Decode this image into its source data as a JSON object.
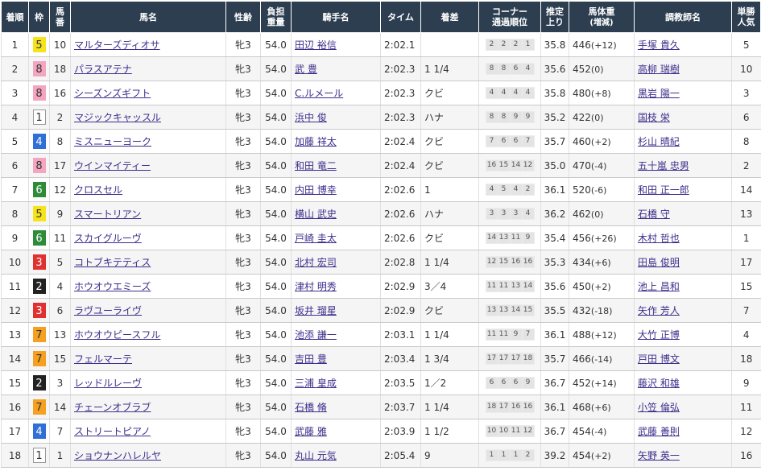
{
  "headers": {
    "rank": "着順",
    "waku": "枠",
    "umaban_1": "馬",
    "umaban_2": "番",
    "horse": "馬名",
    "sexage": "性齢",
    "weight_1": "負担",
    "weight_2": "重量",
    "jockey": "騎手名",
    "time": "タイム",
    "margin": "着差",
    "corner_1": "コーナー",
    "corner_2": "通過順位",
    "last_1": "推定",
    "last_2": "上り",
    "bw_1": "馬体重",
    "bw_2": "(増減)",
    "trainer": "調教師名",
    "odds_1": "単勝",
    "odds_2": "人気"
  },
  "waku_colors": {
    "1": {
      "bg": "#ffffff",
      "fg": "#333333",
      "border": "#999999"
    },
    "2": {
      "bg": "#222222",
      "fg": "#ffffff",
      "border": "#222222"
    },
    "3": {
      "bg": "#e03030",
      "fg": "#ffffff",
      "border": "#e03030"
    },
    "4": {
      "bg": "#2f6fd6",
      "fg": "#ffffff",
      "border": "#2f6fd6"
    },
    "5": {
      "bg": "#f5e31c",
      "fg": "#333333",
      "border": "#f5e31c"
    },
    "6": {
      "bg": "#2e8b3a",
      "fg": "#ffffff",
      "border": "#2e8b3a"
    },
    "7": {
      "bg": "#f5a020",
      "fg": "#333333",
      "border": "#f5a020"
    },
    "8": {
      "bg": "#f4a6c0",
      "fg": "#333333",
      "border": "#f4a6c0"
    }
  },
  "rows": [
    {
      "rank": "1",
      "waku": "5",
      "umaban": "10",
      "horse": "マルターズディオサ",
      "sexage": "牝3",
      "weight": "54.0",
      "jockey": "田辺 裕信",
      "time": "2:02.1",
      "margin": "",
      "corner": [
        "2",
        "2",
        "2",
        "1"
      ],
      "last": "35.8",
      "bw": "446",
      "bwdiff": "(+12)",
      "trainer": "手塚 貴久",
      "pop": "5"
    },
    {
      "rank": "2",
      "waku": "8",
      "umaban": "18",
      "horse": "パラスアテナ",
      "sexage": "牝3",
      "weight": "54.0",
      "jockey": "武 豊",
      "time": "2:02.3",
      "margin": "1 1/4",
      "corner": [
        "8",
        "8",
        "6",
        "4"
      ],
      "last": "35.6",
      "bw": "452",
      "bwdiff": "(0)",
      "trainer": "高柳 瑞樹",
      "pop": "10"
    },
    {
      "rank": "3",
      "waku": "8",
      "umaban": "16",
      "horse": "シーズンズギフト",
      "sexage": "牝3",
      "weight": "54.0",
      "jockey": "C.ルメール",
      "time": "2:02.3",
      "margin": "クビ",
      "corner": [
        "4",
        "4",
        "4",
        "4"
      ],
      "last": "35.8",
      "bw": "480",
      "bwdiff": "(+8)",
      "trainer": "黒岩 陽一",
      "pop": "3"
    },
    {
      "rank": "4",
      "waku": "1",
      "umaban": "2",
      "horse": "マジックキャッスル",
      "sexage": "牝3",
      "weight": "54.0",
      "jockey": "浜中 俊",
      "time": "2:02.3",
      "margin": "ハナ",
      "corner": [
        "8",
        "8",
        "9",
        "9"
      ],
      "last": "35.2",
      "bw": "422",
      "bwdiff": "(0)",
      "trainer": "国枝 栄",
      "pop": "6"
    },
    {
      "rank": "5",
      "waku": "4",
      "umaban": "8",
      "horse": "ミスニューヨーク",
      "sexage": "牝3",
      "weight": "54.0",
      "jockey": "加藤 祥太",
      "time": "2:02.4",
      "margin": "クビ",
      "corner": [
        "7",
        "6",
        "6",
        "7"
      ],
      "last": "35.7",
      "bw": "460",
      "bwdiff": "(+2)",
      "trainer": "杉山 晴紀",
      "pop": "8"
    },
    {
      "rank": "6",
      "waku": "8",
      "umaban": "17",
      "horse": "ウインマイティー",
      "sexage": "牝3",
      "weight": "54.0",
      "jockey": "和田 竜二",
      "time": "2:02.4",
      "margin": "クビ",
      "corner": [
        "16",
        "15",
        "14",
        "12"
      ],
      "last": "35.0",
      "bw": "470",
      "bwdiff": "(-4)",
      "trainer": "五十嵐 忠男",
      "pop": "2"
    },
    {
      "rank": "7",
      "waku": "6",
      "umaban": "12",
      "horse": "クロスセル",
      "sexage": "牝3",
      "weight": "54.0",
      "jockey": "内田 博幸",
      "time": "2:02.6",
      "margin": "1",
      "corner": [
        "4",
        "5",
        "4",
        "2"
      ],
      "last": "36.1",
      "bw": "520",
      "bwdiff": "(-6)",
      "trainer": "和田 正一郎",
      "pop": "14"
    },
    {
      "rank": "8",
      "waku": "5",
      "umaban": "9",
      "horse": "スマートリアン",
      "sexage": "牝3",
      "weight": "54.0",
      "jockey": "横山 武史",
      "time": "2:02.6",
      "margin": "ハナ",
      "corner": [
        "3",
        "3",
        "3",
        "4"
      ],
      "last": "36.2",
      "bw": "462",
      "bwdiff": "(0)",
      "trainer": "石橋 守",
      "pop": "13"
    },
    {
      "rank": "9",
      "waku": "6",
      "umaban": "11",
      "horse": "スカイグルーヴ",
      "sexage": "牝3",
      "weight": "54.0",
      "jockey": "戸崎 圭太",
      "time": "2:02.6",
      "margin": "クビ",
      "corner": [
        "14",
        "13",
        "11",
        "9"
      ],
      "last": "35.4",
      "bw": "456",
      "bwdiff": "(+26)",
      "trainer": "木村 哲也",
      "pop": "1"
    },
    {
      "rank": "10",
      "waku": "3",
      "umaban": "5",
      "horse": "コトブキテティス",
      "sexage": "牝3",
      "weight": "54.0",
      "jockey": "北村 宏司",
      "time": "2:02.8",
      "margin": "1 1/4",
      "corner": [
        "12",
        "15",
        "16",
        "16"
      ],
      "last": "35.3",
      "bw": "434",
      "bwdiff": "(+6)",
      "trainer": "田島 俊明",
      "pop": "17"
    },
    {
      "rank": "11",
      "waku": "2",
      "umaban": "4",
      "horse": "ホウオウエミーズ",
      "sexage": "牝3",
      "weight": "54.0",
      "jockey": "津村 明秀",
      "time": "2:02.9",
      "margin": "3／4",
      "corner": [
        "11",
        "11",
        "13",
        "14"
      ],
      "last": "35.6",
      "bw": "450",
      "bwdiff": "(+2)",
      "trainer": "池上 昌和",
      "pop": "15"
    },
    {
      "rank": "12",
      "waku": "3",
      "umaban": "6",
      "horse": "ラヴユーライヴ",
      "sexage": "牝3",
      "weight": "54.0",
      "jockey": "坂井 瑠星",
      "time": "2:02.9",
      "margin": "クビ",
      "corner": [
        "13",
        "13",
        "14",
        "15"
      ],
      "last": "35.5",
      "bw": "432",
      "bwdiff": "(-18)",
      "trainer": "矢作 芳人",
      "pop": "7"
    },
    {
      "rank": "13",
      "waku": "7",
      "umaban": "13",
      "horse": "ホウオウピースフル",
      "sexage": "牝3",
      "weight": "54.0",
      "jockey": "池添 謙一",
      "time": "2:03.1",
      "margin": "1 1/4",
      "corner": [
        "11",
        "11",
        "9",
        "7"
      ],
      "last": "36.1",
      "bw": "488",
      "bwdiff": "(+12)",
      "trainer": "大竹 正博",
      "pop": "4"
    },
    {
      "rank": "14",
      "waku": "7",
      "umaban": "15",
      "horse": "フェルマーテ",
      "sexage": "牝3",
      "weight": "54.0",
      "jockey": "吉田 豊",
      "time": "2:03.4",
      "margin": "1 3/4",
      "corner": [
        "17",
        "17",
        "17",
        "18"
      ],
      "last": "35.7",
      "bw": "466",
      "bwdiff": "(-14)",
      "trainer": "戸田 博文",
      "pop": "18"
    },
    {
      "rank": "15",
      "waku": "2",
      "umaban": "3",
      "horse": "レッドルレーヴ",
      "sexage": "牝3",
      "weight": "54.0",
      "jockey": "三浦 皇成",
      "time": "2:03.5",
      "margin": "1／2",
      "corner": [
        "6",
        "6",
        "6",
        "9"
      ],
      "last": "36.7",
      "bw": "452",
      "bwdiff": "(+14)",
      "trainer": "藤沢 和雄",
      "pop": "9"
    },
    {
      "rank": "16",
      "waku": "7",
      "umaban": "14",
      "horse": "チェーンオブラブ",
      "sexage": "牝3",
      "weight": "54.0",
      "jockey": "石橋 脩",
      "time": "2:03.7",
      "margin": "1 1/4",
      "corner": [
        "18",
        "17",
        "16",
        "16"
      ],
      "last": "36.1",
      "bw": "468",
      "bwdiff": "(+6)",
      "trainer": "小笠 倫弘",
      "pop": "11"
    },
    {
      "rank": "17",
      "waku": "4",
      "umaban": "7",
      "horse": "ストリートピアノ",
      "sexage": "牝3",
      "weight": "54.0",
      "jockey": "武藤 雅",
      "time": "2:03.9",
      "margin": "1 1/2",
      "corner": [
        "10",
        "10",
        "11",
        "12"
      ],
      "last": "36.7",
      "bw": "454",
      "bwdiff": "(-4)",
      "trainer": "武藤 善則",
      "pop": "12"
    },
    {
      "rank": "18",
      "waku": "1",
      "umaban": "1",
      "horse": "ショウナンハレルヤ",
      "sexage": "牝3",
      "weight": "54.0",
      "jockey": "丸山 元気",
      "time": "2:05.4",
      "margin": "9",
      "corner": [
        "1",
        "1",
        "1",
        "2"
      ],
      "last": "39.2",
      "bw": "454",
      "bwdiff": "(+2)",
      "trainer": "矢野 英一",
      "pop": "16"
    }
  ]
}
